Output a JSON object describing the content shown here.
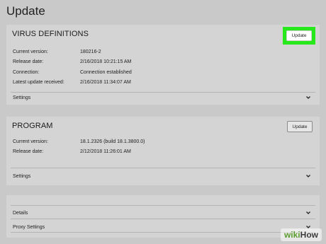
{
  "page_title": "Update",
  "virus": {
    "title": "VIRUS DEFINITIONS",
    "update_label": "Update",
    "rows": [
      {
        "label": "Current version:",
        "value": "180216-2"
      },
      {
        "label": "Release date:",
        "value": "2/16/2018 10:21:15 AM"
      },
      {
        "label": "Connection:",
        "value": "Connection established"
      },
      {
        "label": "Latest update received:",
        "value": "2/16/2018 11:34:07 AM"
      }
    ],
    "settings_label": "Settings"
  },
  "program": {
    "title": "PROGRAM",
    "update_label": "Update",
    "rows": [
      {
        "label": "Current version:",
        "value": "18.1.2326 (build 18.1.3800.0)"
      },
      {
        "label": "Release date:",
        "value": "2/12/2018 11:26:01 AM"
      }
    ],
    "settings_label": "Settings"
  },
  "extra": {
    "details_label": "Details",
    "proxy_label": "Proxy Settings"
  },
  "watermark": {
    "part1": "wiki",
    "part2": "How"
  },
  "colors": {
    "highlight": "#27e81b",
    "card": "#d4d4d4",
    "background": "#c9c9c9"
  }
}
